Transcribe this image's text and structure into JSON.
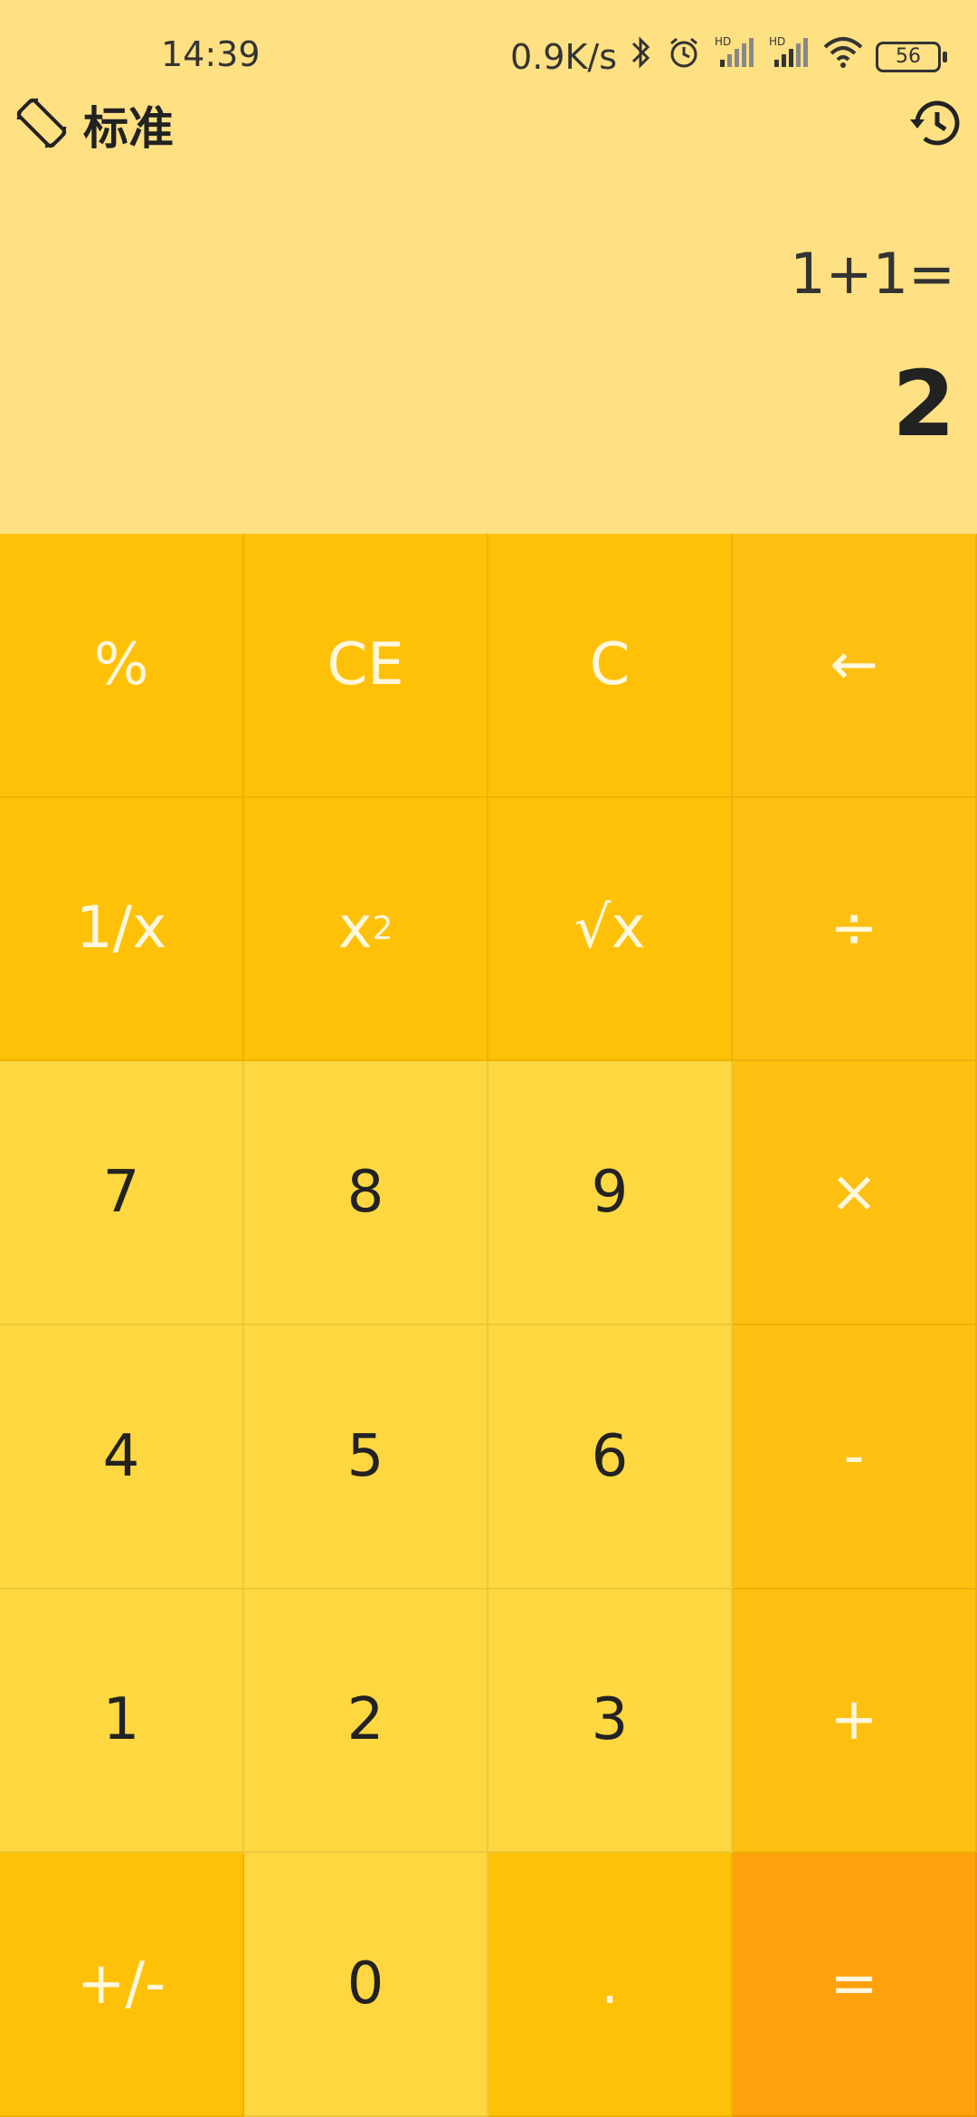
{
  "status_bar": {
    "time": "14:39",
    "speed": "0.9K/s",
    "battery": "56",
    "icons": [
      "bluetooth-icon",
      "alarm-icon",
      "signal-hd-1-icon",
      "signal-hd-2-icon",
      "wifi-icon",
      "battery-icon"
    ]
  },
  "topbar": {
    "mode_label": "标准",
    "mode_icon": "rotate-screen-icon",
    "history_icon": "history-icon"
  },
  "display": {
    "expression": "1+1=",
    "result": "2"
  },
  "keys": {
    "percent": "%",
    "ce": "CE",
    "c": "C",
    "backspace": "←",
    "reciprocal": "1/x",
    "square_base": "x",
    "square_exp": "2",
    "sqrt": "√x",
    "divide": "÷",
    "seven": "7",
    "eight": "8",
    "nine": "9",
    "multiply": "×",
    "four": "4",
    "five": "5",
    "six": "6",
    "minus": "-",
    "one": "1",
    "two": "2",
    "three": "3",
    "plus": "+",
    "negate": "+/-",
    "zero": "0",
    "dot": ".",
    "equals": "="
  },
  "colors": {
    "background": "#FFE082",
    "number_key": "#FFD740",
    "function_key": "#FFC107",
    "operator_key": "#FDC010",
    "equals_key": "#FFA10A"
  }
}
